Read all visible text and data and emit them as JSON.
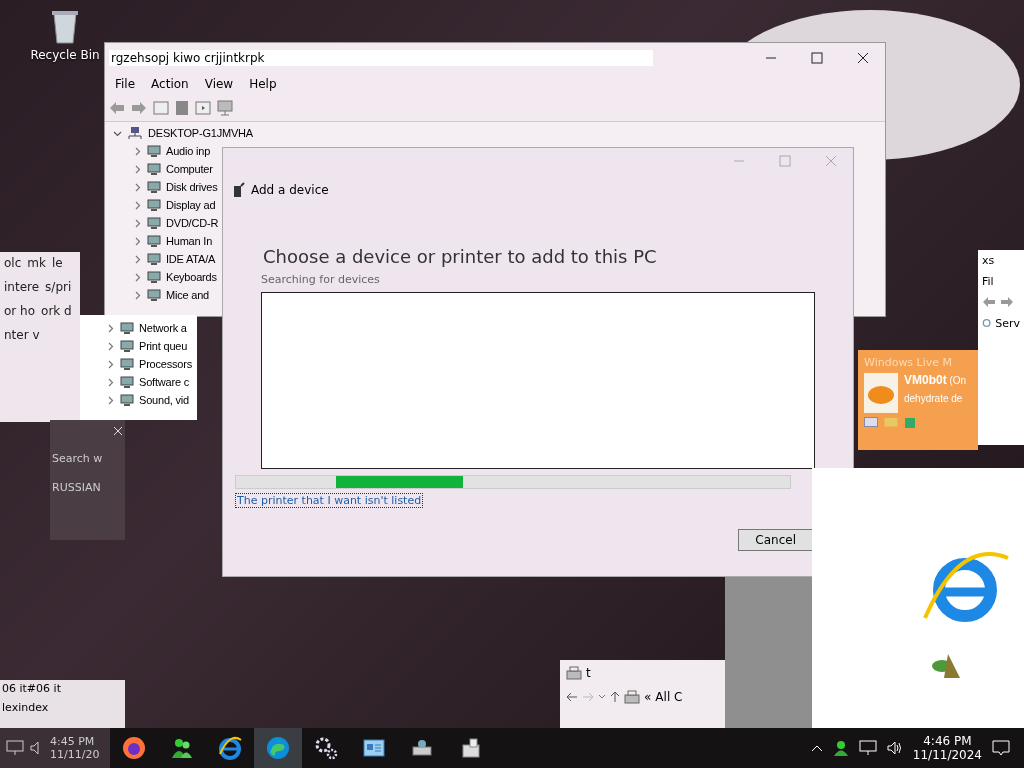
{
  "desktop_icons": [
    {
      "label": "Recycle Bin"
    }
  ],
  "device_manager": {
    "title": "rgzehsopj kiwo crjjintkrpk",
    "menu": [
      "File",
      "Action",
      "View",
      "Help"
    ],
    "root": {
      "label": "DESKTOP-G1JMVHA",
      "expanded": true,
      "children": [
        {
          "label": "Audio inp",
          "expanded": false
        },
        {
          "label": "Computer",
          "expanded": false
        },
        {
          "label": "Disk drives",
          "expanded": false
        },
        {
          "label": "Display ad",
          "expanded": false
        },
        {
          "label": "DVD/CD-R",
          "expanded": false
        },
        {
          "label": "Human In",
          "expanded": false
        },
        {
          "label": "IDE ATA/A",
          "expanded": false
        },
        {
          "label": "Keyboards",
          "expanded": false
        },
        {
          "label": "Mice and",
          "expanded": false
        }
      ]
    }
  },
  "device_manager_slice": {
    "items": [
      {
        "label": "Network a",
        "expanded": false
      },
      {
        "label": "Print queu",
        "expanded": false
      },
      {
        "label": "Processors",
        "expanded": false
      },
      {
        "label": "Software c",
        "expanded": false
      },
      {
        "label": "Sound, vid",
        "expanded": false
      }
    ]
  },
  "add_device": {
    "level": 0.23,
    "title": "Add a device",
    "heading": "Choose a device or printer to add to this PC",
    "status": "Searching for devices",
    "link": "The printer that I want isn't listed",
    "cancel": "Cancel"
  },
  "left_fragments": {
    "top": [
      "olc",
      "mk",
      "le",
      "intere",
      "s/pri",
      "or ho",
      "ork d",
      "nter v"
    ],
    "dark_panel": [
      "Search w",
      "RUSSIAN"
    ],
    "bottom": [
      "06 it#06 it",
      "lexindex"
    ],
    "clock": {
      "time": "4:45 PM",
      "date": "11/11/20"
    }
  },
  "messenger": {
    "brand": "Windows Live M",
    "name": "VM0b0t",
    "presence": "(On",
    "message": "dehydrate de"
  },
  "right_fragment": {
    "title": "xs",
    "menu": "Fil",
    "item": "Serv"
  },
  "explorer_fragment": {
    "title": "t",
    "chevrons": "«",
    "path": "All C"
  },
  "taskbar": {
    "apps": [
      {
        "kind": "firefox",
        "selected": false
      },
      {
        "kind": "messenger",
        "selected": false
      },
      {
        "kind": "ie",
        "selected": false
      },
      {
        "kind": "edge",
        "selected": true
      },
      {
        "kind": "gear",
        "selected": false
      },
      {
        "kind": "panel",
        "selected": false
      },
      {
        "kind": "printer",
        "selected": false
      },
      {
        "kind": "device",
        "selected": false
      }
    ],
    "time": "4:46 PM",
    "date": "11/11/2024"
  }
}
